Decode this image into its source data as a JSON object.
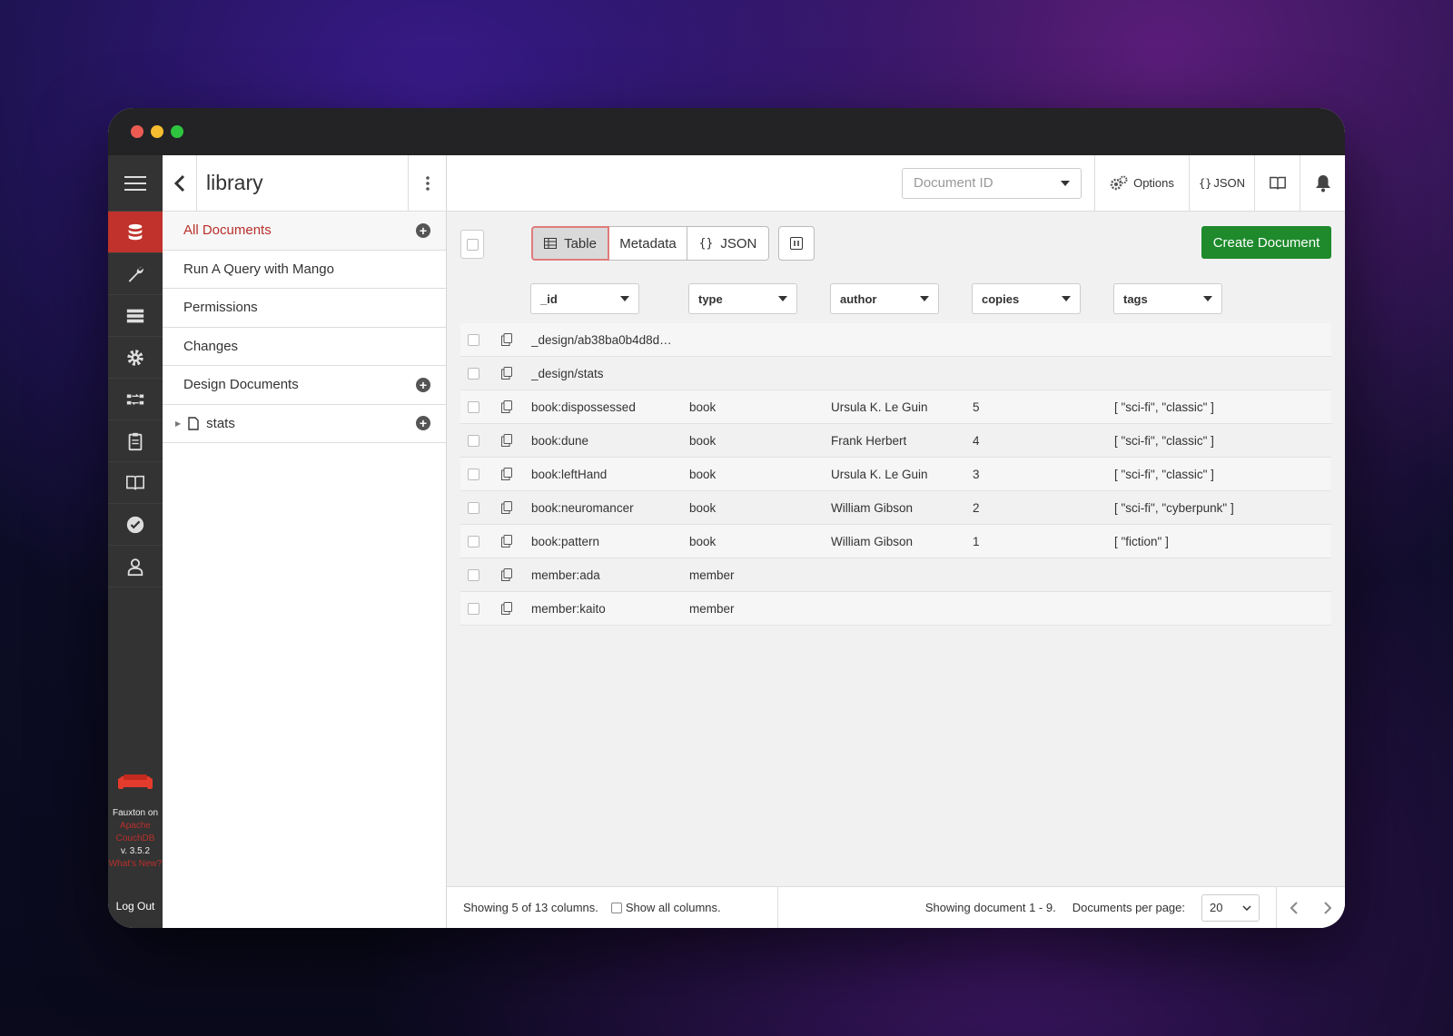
{
  "nav": {
    "icons": [
      "database-icon",
      "wrench-icon",
      "server-icon",
      "gear-icon",
      "replication-icon",
      "clipboard-icon",
      "book-icon",
      "check-icon",
      "user-icon"
    ],
    "brand_line1": "Fauxton on",
    "brand_line2": "Apache",
    "brand_line3": "CouchDB",
    "version": "v. 3.5.2",
    "whats_new": "What's New?",
    "logout": "Log Out"
  },
  "sidebar": {
    "title": "library",
    "items": [
      {
        "label": "All Documents"
      },
      {
        "label": "Run A Query with Mango"
      },
      {
        "label": "Permissions"
      },
      {
        "label": "Changes"
      },
      {
        "label": "Design Documents"
      },
      {
        "label": "stats"
      }
    ]
  },
  "topbar": {
    "docid_placeholder": "Document ID",
    "options": "Options",
    "json": "JSON"
  },
  "toolbar": {
    "table": "Table",
    "metadata": "Metadata",
    "json": "JSON",
    "create": "Create Document"
  },
  "columns": [
    "_id",
    "type",
    "author",
    "copies",
    "tags"
  ],
  "rows": [
    {
      "id": "_design/ab38ba0b4d8d…",
      "type": "",
      "author": "",
      "copies": "",
      "tags": ""
    },
    {
      "id": "_design/stats",
      "type": "",
      "author": "",
      "copies": "",
      "tags": ""
    },
    {
      "id": "book:dispossessed",
      "type": "book",
      "author": "Ursula K. Le Guin",
      "copies": "5",
      "tags": "[ \"sci-fi\", \"classic\" ]"
    },
    {
      "id": "book:dune",
      "type": "book",
      "author": "Frank Herbert",
      "copies": "4",
      "tags": "[ \"sci-fi\", \"classic\" ]"
    },
    {
      "id": "book:leftHand",
      "type": "book",
      "author": "Ursula K. Le Guin",
      "copies": "3",
      "tags": "[ \"sci-fi\", \"classic\" ]"
    },
    {
      "id": "book:neuromancer",
      "type": "book",
      "author": "William Gibson",
      "copies": "2",
      "tags": "[ \"sci-fi\", \"cyberpunk\" ]"
    },
    {
      "id": "book:pattern",
      "type": "book",
      "author": "William Gibson",
      "copies": "1",
      "tags": "[ \"fiction\" ]"
    },
    {
      "id": "member:ada",
      "type": "member",
      "author": "",
      "copies": "",
      "tags": ""
    },
    {
      "id": "member:kaito",
      "type": "member",
      "author": "",
      "copies": "",
      "tags": ""
    }
  ],
  "footer": {
    "columns_info": "Showing 5 of 13 columns.",
    "show_all": "Show all columns.",
    "docs_info": "Showing document 1 - 9.",
    "per_page_label": "Documents per page:",
    "per_page_value": "20"
  },
  "colors": {
    "accent": "#c0322b",
    "create": "#1e8a2c"
  }
}
